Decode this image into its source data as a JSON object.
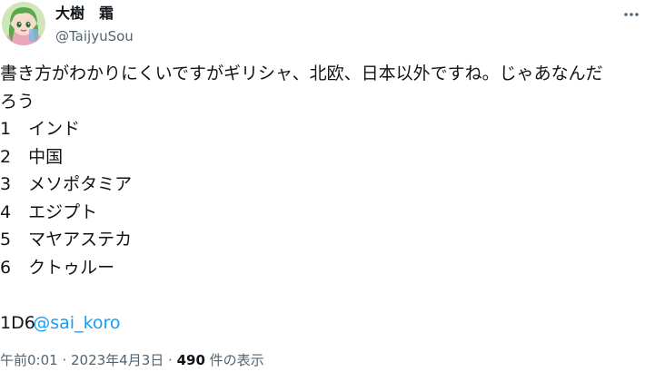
{
  "author": {
    "display_name": "大樹　霜",
    "handle": "@TaijyuSou",
    "avatar_icon": "anime-character-avatar"
  },
  "more_icon": "more-horizontal-icon",
  "tweet": {
    "lines": [
      "書き方がわかりにくいですがギリシャ、北欧、日本以外ですね。じゃあなんだ",
      "ろう",
      "1　インド",
      "2　中国",
      "3　メソポタミア",
      "4　エジプト",
      "5　マヤアステカ",
      "6　クトゥルー"
    ],
    "mention": "@sai_koro",
    "dice": "1D6"
  },
  "meta": {
    "time": "午前0:01",
    "separator_1": " · ",
    "date": "2023年4月3日",
    "separator_2": " · ",
    "views_count": "490",
    "views_label": " 件の表示"
  },
  "colors": {
    "link": "#1d9bf0",
    "secondary_text": "#536471",
    "primary_text": "#0f1419"
  }
}
